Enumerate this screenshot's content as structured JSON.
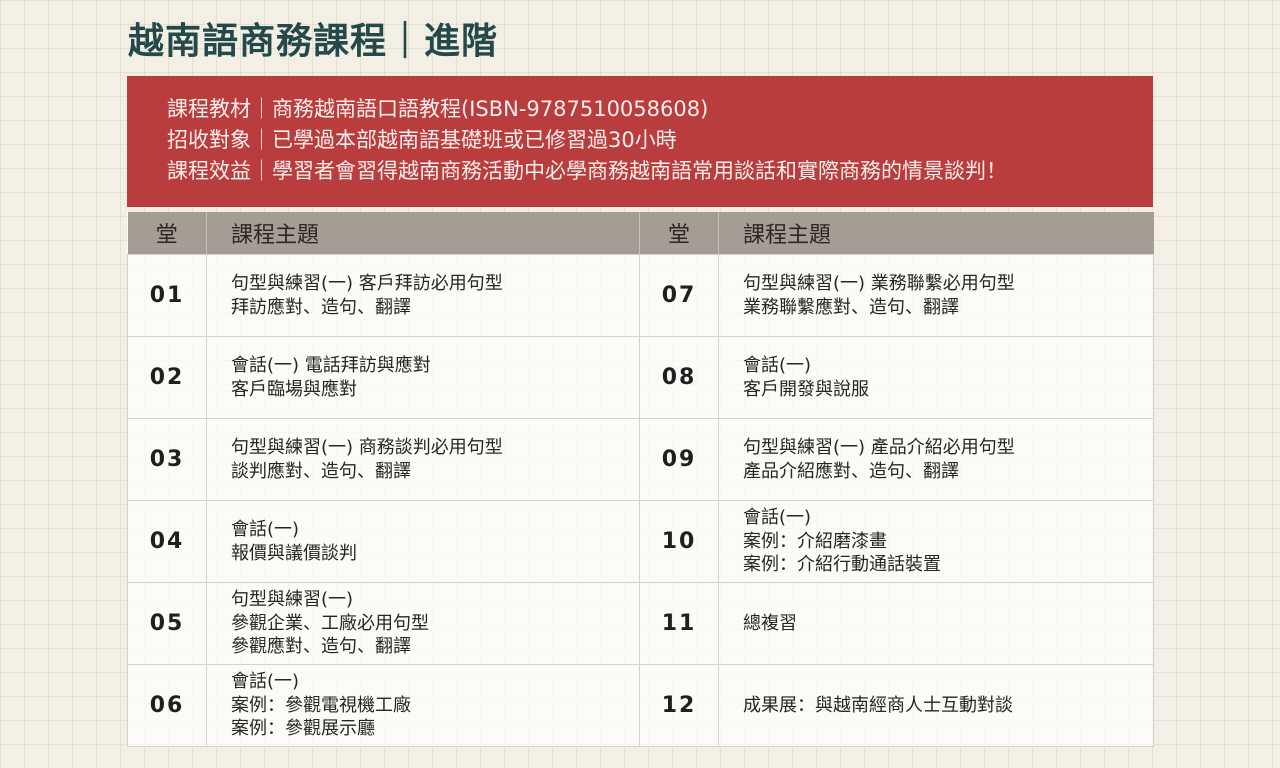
{
  "title": "越南語商務課程｜進階",
  "banner": {
    "lines": [
      "課程教材｜商務越南語口語教程(ISBN-9787510058608)",
      "招收對象｜已學過本部越南語基礎班或已修習過30小時",
      "課程效益｜學習者會習得越南商務活動中必學商務越南語常用談話和實際商務的情景談判！"
    ]
  },
  "table": {
    "headers": {
      "num": "堂",
      "topic": "課程主題"
    },
    "rows": [
      {
        "left": {
          "num": "01",
          "lines": [
            "句型與練習(一) 客戶拜訪必用句型",
            "拜訪應對、造句、翻譯"
          ]
        },
        "right": {
          "num": "07",
          "lines": [
            "句型與練習(一) 業務聯繫必用句型",
            "業務聯繫應對、造句、翻譯"
          ]
        }
      },
      {
        "left": {
          "num": "02",
          "lines": [
            "會話(一) 電話拜訪與應對",
            "客戶臨場與應對"
          ]
        },
        "right": {
          "num": "08",
          "lines": [
            "會話(一)",
            "客戶開發與說服"
          ]
        }
      },
      {
        "left": {
          "num": "03",
          "lines": [
            "句型與練習(一) 商務談判必用句型",
            "談判應對、造句、翻譯"
          ]
        },
        "right": {
          "num": "09",
          "lines": [
            "句型與練習(一) 產品介紹必用句型",
            "產品介紹應對、造句、翻譯"
          ]
        }
      },
      {
        "left": {
          "num": "04",
          "lines": [
            "會話(一)",
            "報價與議價談判"
          ]
        },
        "right": {
          "num": "10",
          "lines": [
            "會話(一)",
            "案例：介紹磨漆畫",
            "案例：介紹行動通話裝置"
          ]
        }
      },
      {
        "left": {
          "num": "05",
          "lines": [
            "句型與練習(一)",
            "參觀企業、工廠必用句型",
            "參觀應對、造句、翻譯"
          ]
        },
        "right": {
          "num": "11",
          "lines": [
            "總複習"
          ]
        }
      },
      {
        "left": {
          "num": "06",
          "lines": [
            "會話(一)",
            "案例：參觀電視機工廠",
            "案例：參觀展示廳"
          ]
        },
        "right": {
          "num": "12",
          "lines": [
            "成果展：與越南經商人士互動對談"
          ]
        }
      }
    ]
  }
}
